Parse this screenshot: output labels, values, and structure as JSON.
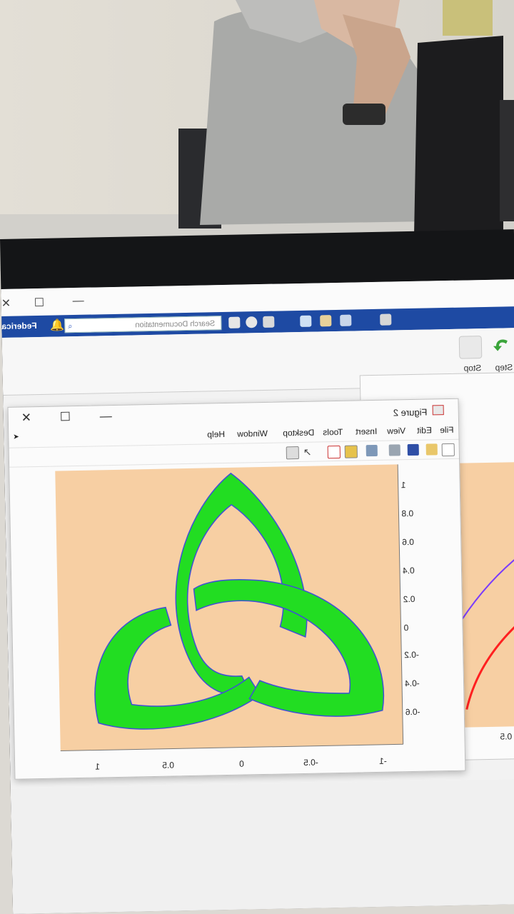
{
  "matlab": {
    "user_name": "Federica",
    "search_placeholder": "Search Documentation",
    "ribbon": {
      "step_label": "Step",
      "stop_label": "Stop"
    }
  },
  "figure": {
    "title": "Figure 2",
    "menu": [
      "File",
      "Edit",
      "View",
      "Insert",
      "Tools",
      "Desktop",
      "Window",
      "Help"
    ],
    "y_ticks": [
      "1",
      "0.8",
      "0.6",
      "0.4",
      "0.2",
      "0",
      "-0.2",
      "-0.4",
      "-0.6"
    ],
    "x_ticks": [
      "1",
      "0.5",
      "0",
      "-0.5",
      "-1"
    ],
    "colors": {
      "axes_bg": "#f7cfa3",
      "knot_fill": "#22dd22",
      "knot_edge": "#3f4fd6"
    }
  },
  "figure2": {
    "x_tick": "0.5"
  },
  "icons": [
    "minimize-icon",
    "maximize-icon",
    "close-icon",
    "search-icon",
    "bell-icon",
    "help-icon",
    "step-icon",
    "stop-icon"
  ]
}
